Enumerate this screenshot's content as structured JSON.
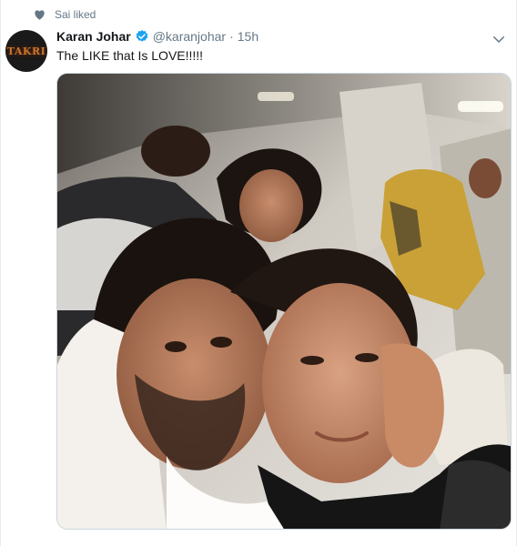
{
  "social_context": {
    "text": "Sai liked",
    "icon": "heart-icon"
  },
  "author": {
    "avatar_text": "TAKRI",
    "name": "Karan Johar",
    "verified_icon": "verified-badge-icon",
    "handle": "@karanjohar",
    "separator": "·",
    "time": "15h"
  },
  "tweet": {
    "text": "The LIKE that Is LOVE!!!!!",
    "caret_icon": "chevron-down-icon",
    "media_alt": "Selfie photo inside a private jet"
  },
  "colors": {
    "verified": "#1da1f2",
    "secondary_text": "#657786",
    "primary_text": "#14171a"
  }
}
